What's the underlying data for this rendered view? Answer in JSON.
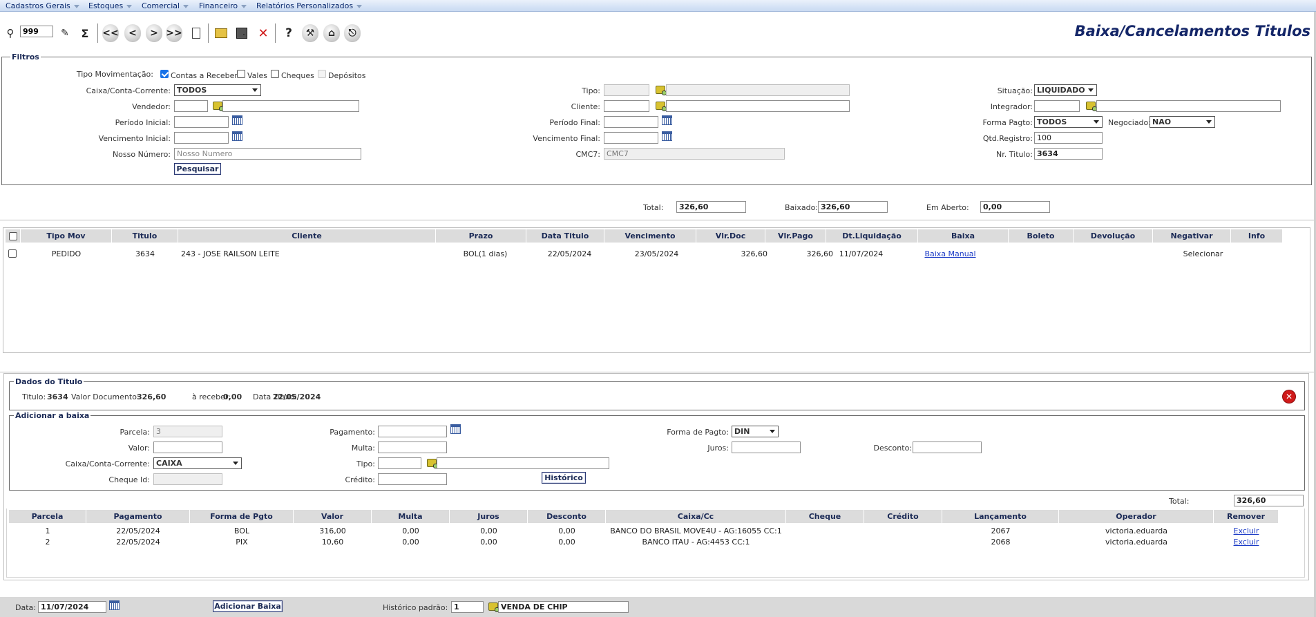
{
  "menu": [
    "Cadastros Gerais",
    "Estoques",
    "Comercial",
    "Financeiro",
    "Relatórios Personalizados"
  ],
  "toolbar": {
    "records_value": "999",
    "buttons": [
      "binoculars-icon",
      "edit-icon",
      "sum-icon",
      "first-icon",
      "prev-icon",
      "next-icon",
      "last-icon",
      "new-icon",
      "open-icon",
      "save-icon",
      "delete-icon",
      "help-icon",
      "tools-icon",
      "home-icon",
      "exit-icon"
    ],
    "glyphs": {
      "first": "<<",
      "prev": "<",
      "next": ">",
      "last": ">>",
      "sum": "Σ",
      "help": "?",
      "delete": "✕"
    }
  },
  "title": "Baixa/Cancelamentos Titulos",
  "filters": {
    "legend": "Filtros",
    "tipo_mov_label": "Tipo Movimentação:",
    "opt_receber": "Contas a Receber",
    "opt_vales": "Vales",
    "opt_cheques": "Cheques",
    "opt_depositos": "Depósitos",
    "caixa_label": "Caixa/Conta-Corrente:",
    "caixa_value": "TODOS",
    "vendedor_label": "Vendedor:",
    "periodo_inicial_label": "Período Inicial:",
    "vencimento_inicial_label": "Vencimento Inicial:",
    "nosso_numero_label": "Nosso Número:",
    "nosso_numero_placeholder": "Nosso Numero",
    "search_button": "Pesquisar",
    "tipo_label": "Tipo:",
    "cliente_label": "Cliente:",
    "periodo_final_label": "Período Final:",
    "vencimento_final_label": "Vencimento Final:",
    "cmc7_label": "CMC7:",
    "cmc7_placeholder": "CMC7",
    "situacao_label": "Situação:",
    "situacao_value": "LIQUIDADO",
    "integrador_label": "Integrador:",
    "forma_pagto_label": "Forma Pagto:",
    "forma_pagto_value": "TODOS",
    "negociado_label": "Negociado:",
    "negociado_value": "NAO",
    "qtd_registro_label": "Qtd.Registro:",
    "qtd_registro_value": "100",
    "nr_titulo_label": "Nr. Titulo:",
    "nr_titulo_value": "3634"
  },
  "totals": {
    "total_label": "Total:",
    "total_value": "326,60",
    "baixado_label": "Baixado:",
    "baixado_value": "326,60",
    "aberto_label": "Em Aberto:",
    "aberto_value": "0,00"
  },
  "titles_table": {
    "headers": [
      "Tipo Mov",
      "Titulo",
      "Cliente",
      "Prazo",
      "Data Titulo",
      "Vencimento",
      "Vlr.Doc",
      "Vlr.Pago",
      "Dt.Liquidação",
      "Baixa",
      "Boleto",
      "Devolução",
      "Negativar",
      "Info"
    ],
    "rows": [
      {
        "tipo_mov": "PEDIDO",
        "titulo": "3634",
        "cliente": "243 - JOSE RAILSON LEITE",
        "prazo": "BOL(1 dias)",
        "data_titulo": "22/05/2024",
        "vencimento": "23/05/2024",
        "vlr_doc": "326,60",
        "vlr_pago": "326,60",
        "dt_liquidacao": "11/07/2024",
        "baixa": "Baixa Manual",
        "boleto": "",
        "devolucao": "",
        "negativar": "Selecionar",
        "info": ""
      }
    ]
  },
  "dados_titulo": {
    "legend": "Dados do Titulo",
    "titulo_label": "Titulo:",
    "titulo_value": "3634",
    "valor_doc_label": "Valor Documento:",
    "valor_doc_value": "326,60",
    "receber_label": "à receber:",
    "receber_value": "0,00",
    "data_titulo_label": "Data Titulo:",
    "data_titulo_value": "22/05/2024"
  },
  "adicionar": {
    "legend": "Adicionar a baixa",
    "parcela_label": "Parcela:",
    "parcela_value": "3",
    "valor_label": "Valor:",
    "caixa_label": "Caixa/Conta-Corrente:",
    "caixa_value": "CAIXA",
    "cheque_label": "Cheque Id:",
    "pagamento_label": "Pagamento:",
    "multa_label": "Multa:",
    "tipo_label": "Tipo:",
    "credito_label": "Crédito:",
    "historico_button": "Histórico",
    "forma_label": "Forma de Pagto:",
    "forma_value": "DIN",
    "juros_label": "Juros:",
    "desconto_label": "Desconto:"
  },
  "payments": {
    "total_label": "Total:",
    "total_value": "326,60",
    "headers": [
      "Parcela",
      "Pagamento",
      "Forma de Pgto",
      "Valor",
      "Multa",
      "Juros",
      "Desconto",
      "Caixa/Cc",
      "Cheque",
      "Crédito",
      "Lançamento",
      "Operador",
      "Remover"
    ],
    "rows": [
      {
        "parcela": "1",
        "pagamento": "22/05/2024",
        "forma": "BOL",
        "valor": "316,00",
        "multa": "0,00",
        "juros": "0,00",
        "desconto": "0,00",
        "caixa": "BANCO DO BRASIL MOVE4U - AG:16055 CC:1",
        "cheque": "",
        "credito": "",
        "lancamento": "2067",
        "operador": "victoria.eduarda",
        "remover": "Excluir"
      },
      {
        "parcela": "2",
        "pagamento": "22/05/2024",
        "forma": "PIX",
        "valor": "10,60",
        "multa": "0,00",
        "juros": "0,00",
        "desconto": "0,00",
        "caixa": "BANCO ITAU - AG:4453 CC:1",
        "cheque": "",
        "credito": "",
        "lancamento": "2068",
        "operador": "victoria.eduarda",
        "remover": "Excluir"
      }
    ]
  },
  "footer": {
    "data_label": "Data:",
    "data_value": "11/07/2024",
    "add_button": "Adicionar Baixa",
    "historico_label": "Histórico padrão:",
    "historico_code": "1",
    "historico_desc": "VENDA DE CHIP"
  }
}
